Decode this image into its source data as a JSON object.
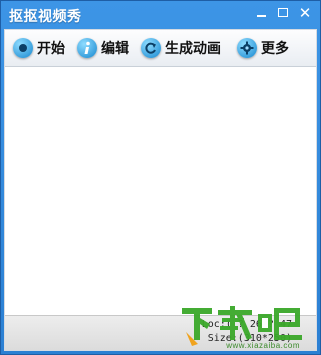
{
  "window": {
    "title": "抠抠视频秀",
    "controls": {
      "minimize": "minimize",
      "maximize": "maximize",
      "close": "✕"
    }
  },
  "toolbar": {
    "items": [
      {
        "label": "开始",
        "icon": "record-icon",
        "color": "#2aa6e8"
      },
      {
        "label": "编辑",
        "icon": "info-icon",
        "color": "#2aa6e8"
      },
      {
        "label": "生成动画",
        "icon": "refresh-icon",
        "color": "#2aa6e8"
      },
      {
        "label": "更多",
        "icon": "gear-icon",
        "color": "#2aa6e8"
      }
    ]
  },
  "status": {
    "location": "Loc:(  ?  26  ?  47",
    "size": "Size:(310*250)"
  },
  "watermark": {
    "logo": "下载吧",
    "url": "www.xiazaiba.com",
    "color": "#3ba82a"
  },
  "colors": {
    "titlebar": "#3d95e6",
    "accent": "#2aa6e8"
  }
}
